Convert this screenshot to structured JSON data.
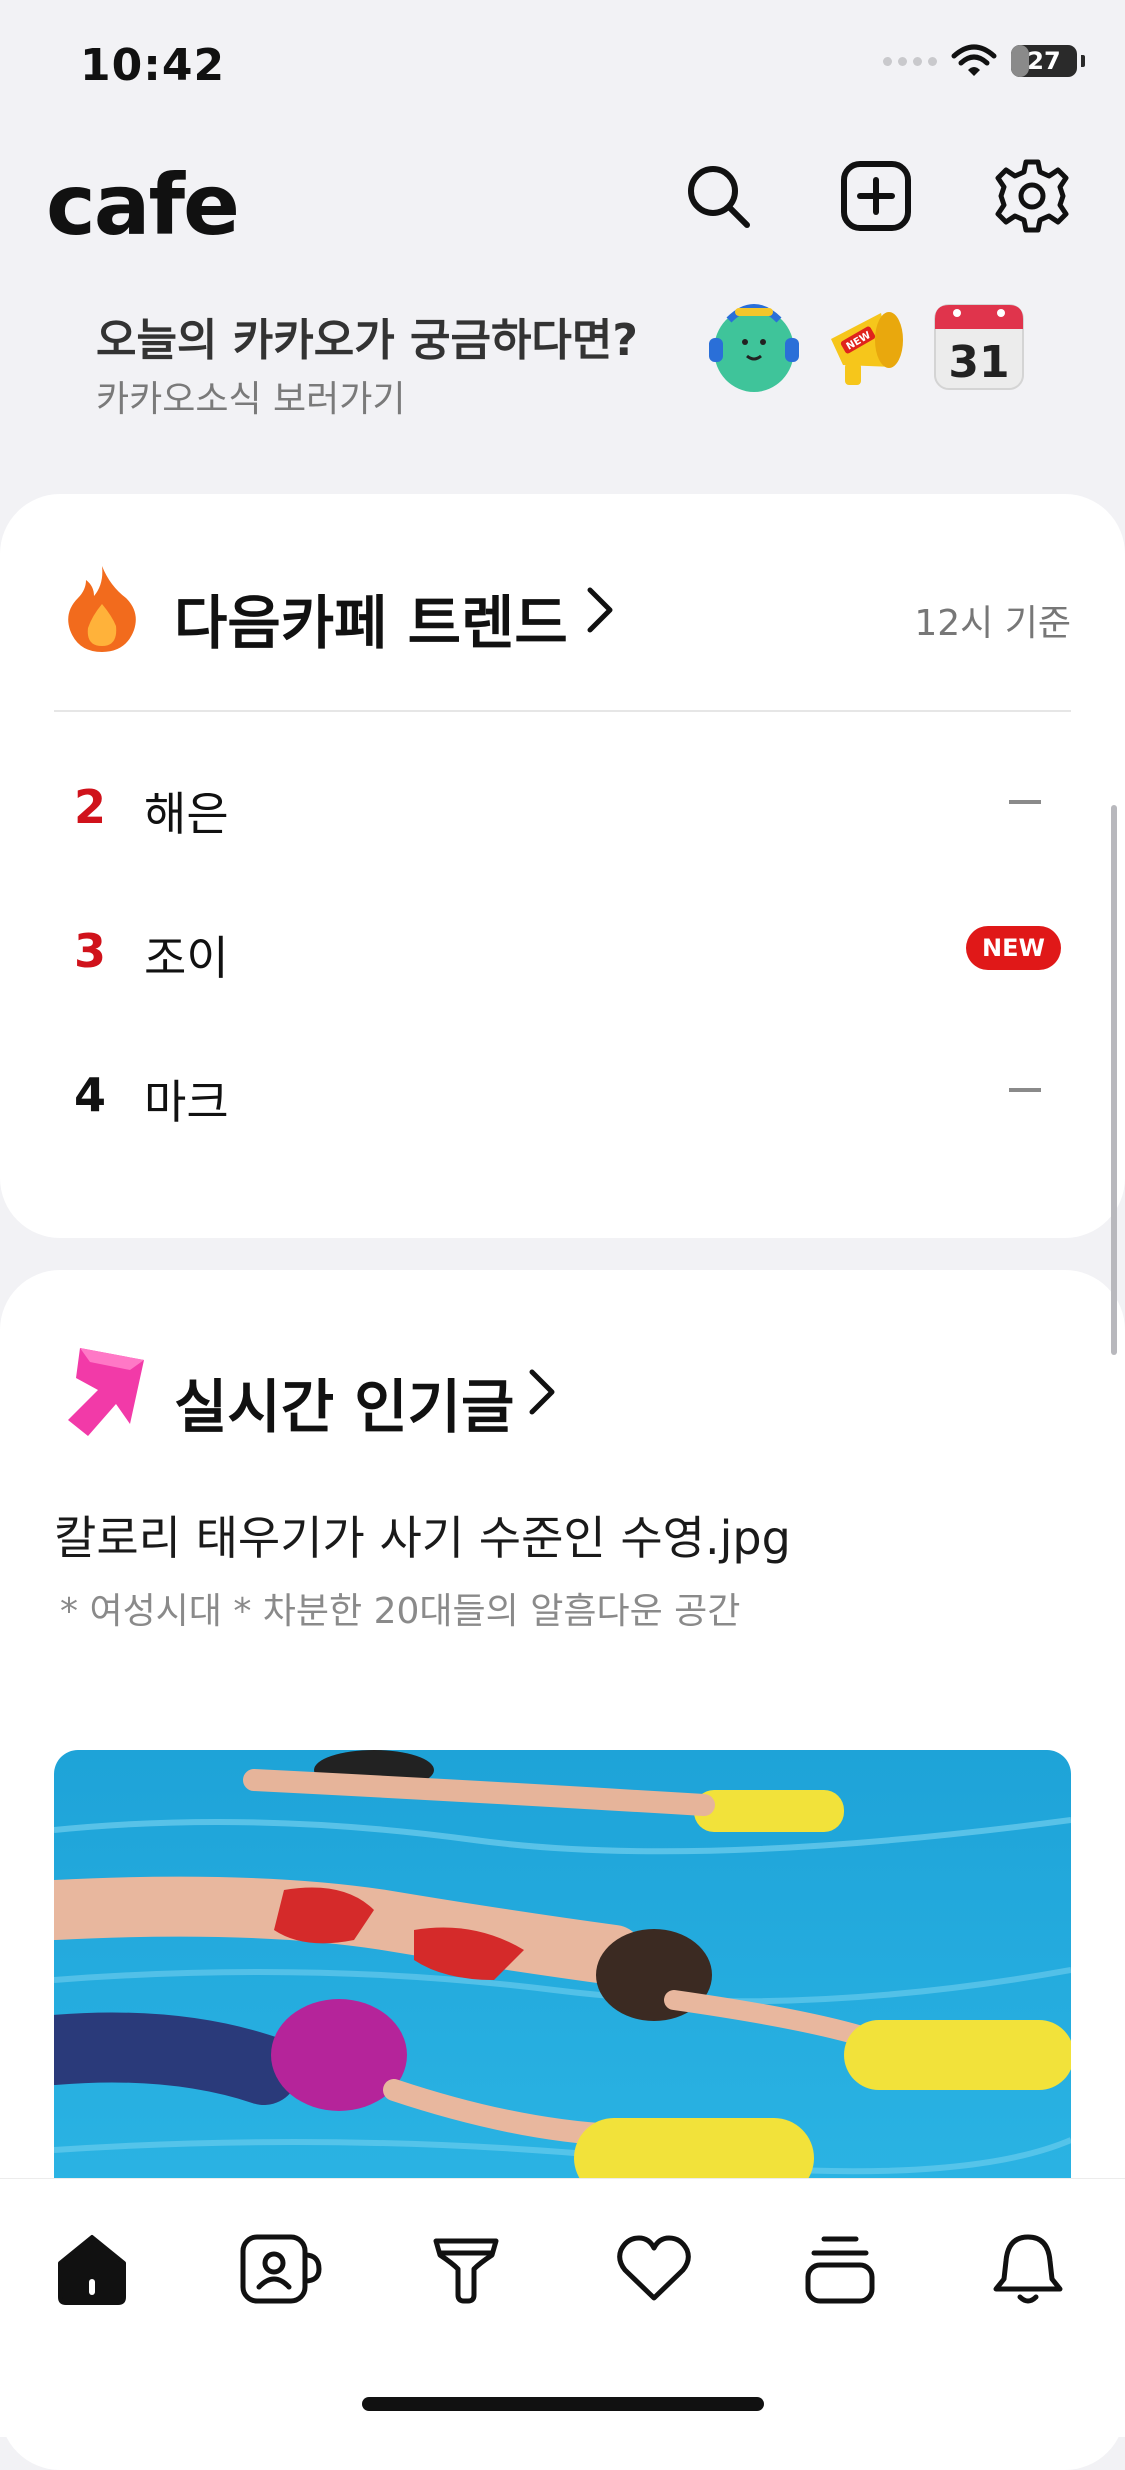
{
  "status": {
    "time": "10:42",
    "battery": "27",
    "battery_level": 0.27
  },
  "header": {
    "logo": "cafe"
  },
  "promo": {
    "title": "오늘의 카카오가 궁금하다면?",
    "subtitle": "카카오소식 보러가기",
    "calendar_day": "31",
    "megaphone_badge": "NEW"
  },
  "trend": {
    "title": "다음카페 트렌드",
    "basis": "12시 기준",
    "items": [
      {
        "rank": "2",
        "term": "해은",
        "status": "same"
      },
      {
        "rank": "3",
        "term": "조이",
        "status": "new",
        "badge": "NEW"
      },
      {
        "rank": "4",
        "term": "마크",
        "status": "same"
      }
    ]
  },
  "popular": {
    "title": "실시간 인기글",
    "post_title": "칼로리 태우기가 사기 수준인 수영.jpg",
    "post_cafe": "* 여성시대 *  차분한 20대들의 알흠다운 공간"
  },
  "colors": {
    "rank_top": "#d0121b",
    "new_badge": "#e01818",
    "pool": "#21a6dc"
  }
}
